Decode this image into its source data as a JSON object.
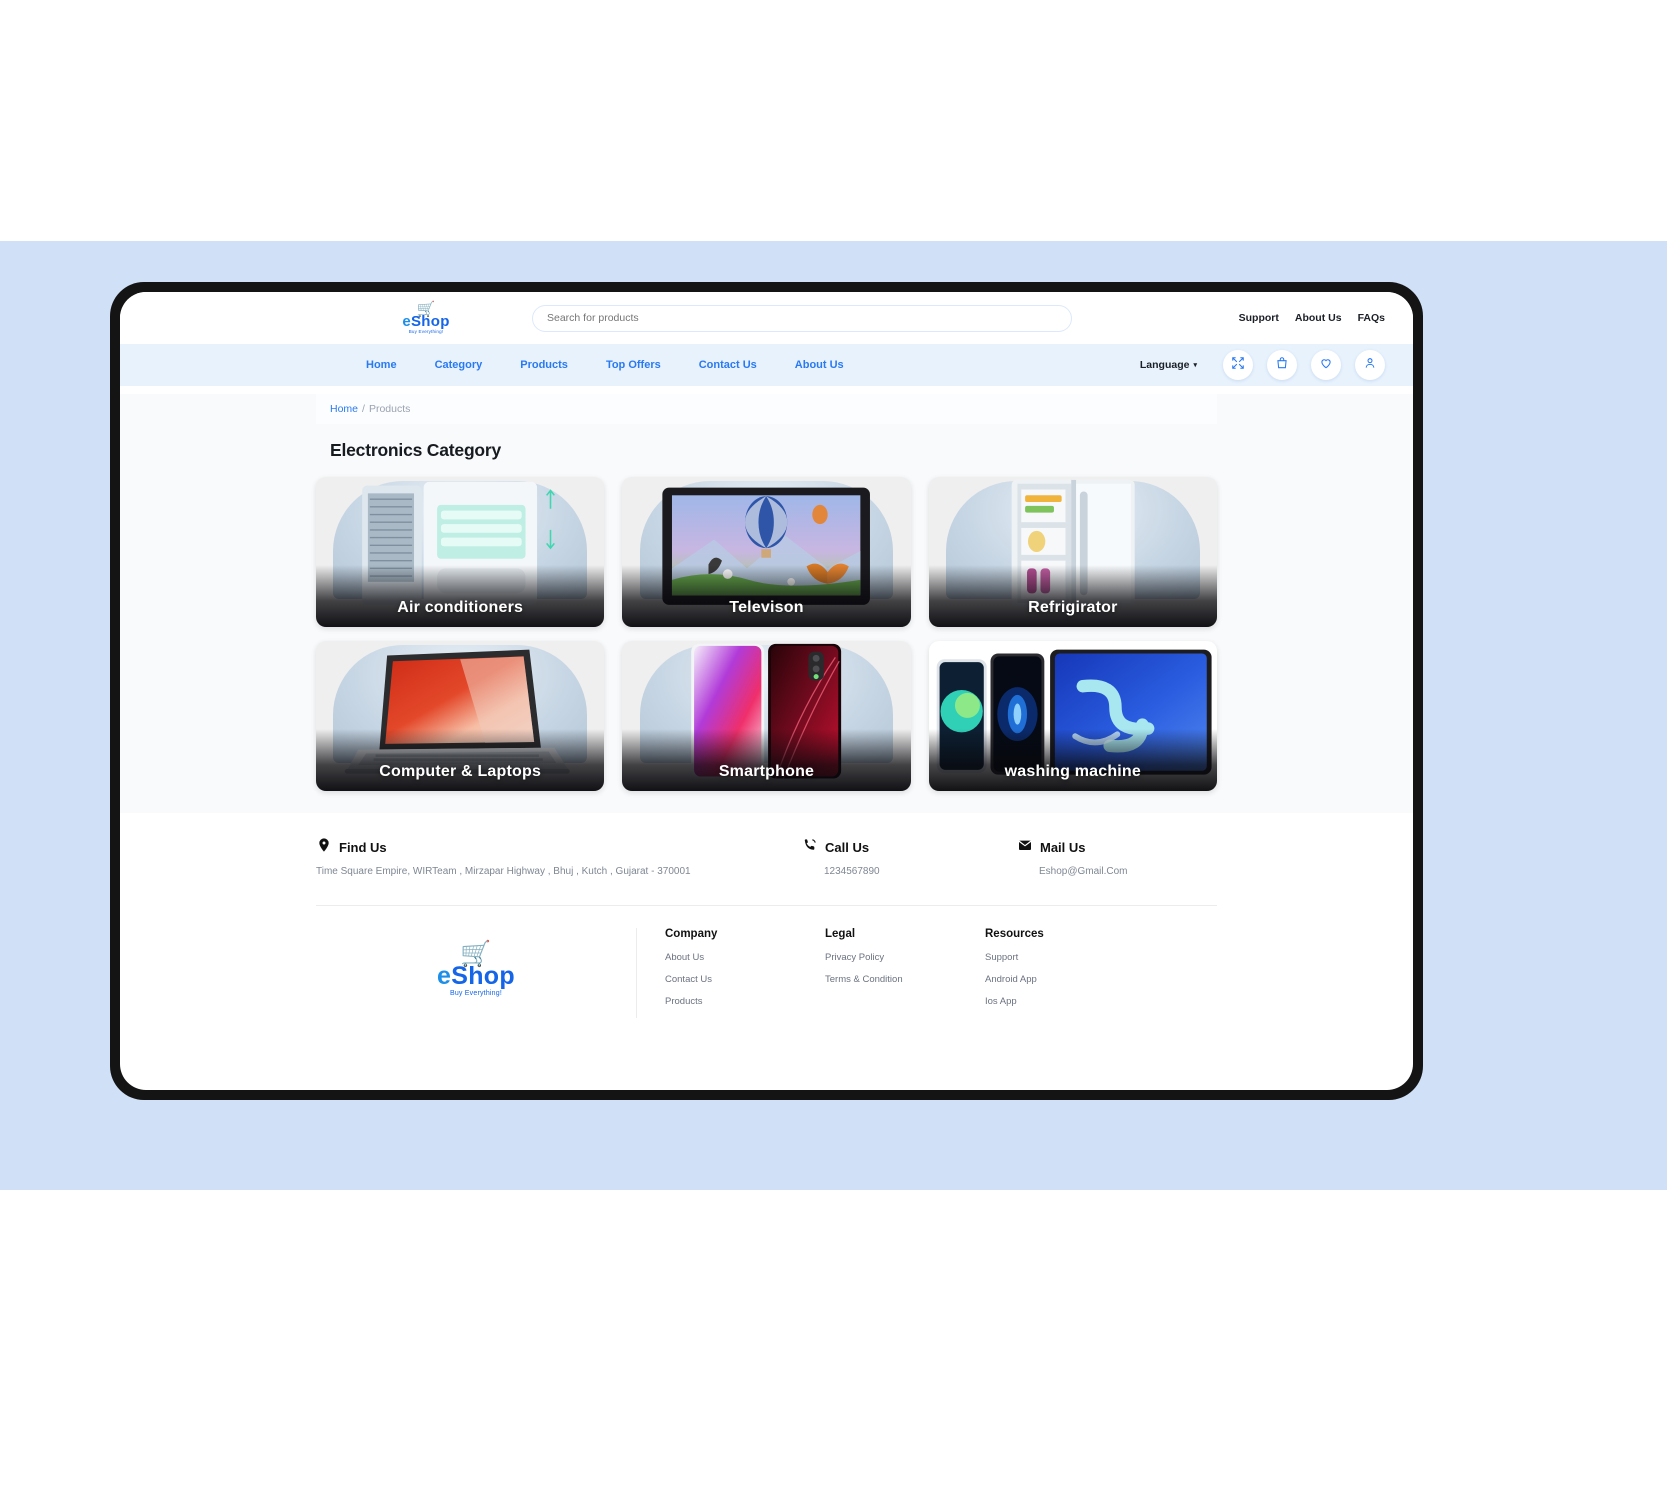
{
  "brand": {
    "name_e": "e",
    "name_rest": "Shop",
    "tagline": "Buy Everything!",
    "cart_icon": "shopping-cart-icon"
  },
  "search": {
    "placeholder": "Search for products",
    "value": ""
  },
  "top_links": [
    {
      "label": "Support"
    },
    {
      "label": "About Us"
    },
    {
      "label": "FAQs"
    }
  ],
  "nav": {
    "items": [
      {
        "label": "Home"
      },
      {
        "label": "Category"
      },
      {
        "label": "Products"
      },
      {
        "label": "Top Offers"
      },
      {
        "label": "Contact Us"
      },
      {
        "label": "About Us"
      }
    ],
    "language_label": "Language",
    "language_caret": "▾",
    "action_icons": [
      {
        "name": "compare-icon"
      },
      {
        "name": "shopping-bag-icon"
      },
      {
        "name": "heart-icon"
      },
      {
        "name": "user-account-icon"
      }
    ]
  },
  "breadcrumb": {
    "home": "Home",
    "separator": "/",
    "current": "Products"
  },
  "page_title": "Electronics Category",
  "categories": [
    {
      "label": "Air conditioners"
    },
    {
      "label": "Televison"
    },
    {
      "label": "Refrigirator"
    },
    {
      "label": "Computer & Laptops"
    },
    {
      "label": "Smartphone"
    },
    {
      "label": "washing machine"
    }
  ],
  "contact": {
    "find": {
      "title": "Find Us",
      "icon": "location-pin-icon",
      "value": "Time Square Empire, WIRTeam , Mirzapar Highway , Bhuj , Kutch , Gujarat - 370001"
    },
    "call": {
      "title": "Call Us",
      "icon": "phone-icon",
      "value": "1234567890"
    },
    "mail": {
      "title": "Mail Us",
      "icon": "envelope-icon",
      "value": "Eshop@Gmail.Com"
    }
  },
  "footer": {
    "columns": [
      {
        "title": "Company",
        "links": [
          {
            "label": "About Us"
          },
          {
            "label": "Contact Us"
          },
          {
            "label": "Products"
          }
        ]
      },
      {
        "title": "Legal",
        "links": [
          {
            "label": "Privacy Policy"
          },
          {
            "label": "Terms & Condition"
          }
        ]
      },
      {
        "title": "Resources",
        "links": [
          {
            "label": "Support"
          },
          {
            "label": "Android App"
          },
          {
            "label": "Ios App"
          }
        ]
      }
    ]
  },
  "colors": {
    "accent": "#2979f2",
    "nav_bg": "#e7f2fd",
    "page_bg": "#cfe0f7",
    "content_bg": "#f8fafc",
    "device_frame": "#141414"
  }
}
